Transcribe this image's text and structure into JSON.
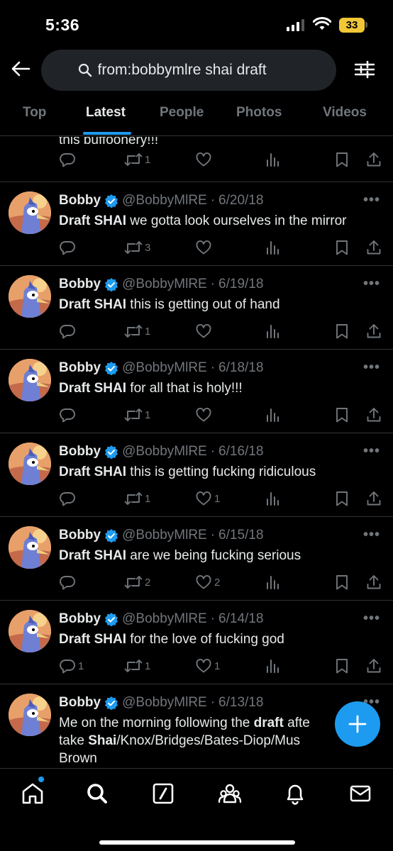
{
  "status_bar": {
    "time": "5:36",
    "battery": "33"
  },
  "search": {
    "query": "from:bobbymlre shai draft"
  },
  "tabs": [
    {
      "label": "Top",
      "active": false
    },
    {
      "label": "Latest",
      "active": true
    },
    {
      "label": "People",
      "active": false
    },
    {
      "label": "Photos",
      "active": false
    },
    {
      "label": "Videos",
      "active": false
    }
  ],
  "colors": {
    "accent": "#1d9bf0",
    "background": "#000000",
    "muted": "#71767b",
    "battery": "#f2c737"
  },
  "truncated_tweet": {
    "text": "this buffoonery!!!",
    "retweets": "1"
  },
  "tweets": [
    {
      "name": "Bobby",
      "handle": "@BobbyMlRE",
      "date": "6/20/18",
      "bold": "Draft SHAI",
      "rest": " we gotta look ourselves in the mirror",
      "replies": "",
      "retweets": "3",
      "likes": ""
    },
    {
      "name": "Bobby",
      "handle": "@BobbyMlRE",
      "date": "6/19/18",
      "bold": "Draft SHAI",
      "rest": " this is getting out of hand",
      "replies": "",
      "retweets": "1",
      "likes": ""
    },
    {
      "name": "Bobby",
      "handle": "@BobbyMlRE",
      "date": "6/18/18",
      "bold": "Draft SHAI",
      "rest": " for all that is holy!!!",
      "replies": "",
      "retweets": "1",
      "likes": ""
    },
    {
      "name": "Bobby",
      "handle": "@BobbyMlRE",
      "date": "6/16/18",
      "bold": "Draft SHAI",
      "rest": " this is getting fucking ridiculous",
      "replies": "",
      "retweets": "1",
      "likes": "1"
    },
    {
      "name": "Bobby",
      "handle": "@BobbyMlRE",
      "date": "6/15/18",
      "bold": "Draft SHAI",
      "rest": " are we being fucking serious",
      "replies": "",
      "retweets": "2",
      "likes": "2"
    },
    {
      "name": "Bobby",
      "handle": "@BobbyMlRE",
      "date": "6/14/18",
      "bold": "Draft SHAI",
      "rest": " for the love of fucking god",
      "replies": "1",
      "retweets": "1",
      "likes": "1"
    }
  ],
  "last_tweet": {
    "name": "Bobby",
    "handle": "@BobbyMlRE",
    "date": "6/13/18",
    "line1_pre": "Me on the morning following the ",
    "line1_bold": "draft",
    "line1_post": " afte",
    "line2_pre": "take ",
    "line2_bold": "Shai",
    "line2_post": "/Knox/Bridges/Bates-Diop/Mus",
    "line3": "Brown"
  },
  "nav": [
    "home-icon",
    "search-icon",
    "grok-icon",
    "communities-icon",
    "notifications-icon",
    "messages-icon"
  ]
}
